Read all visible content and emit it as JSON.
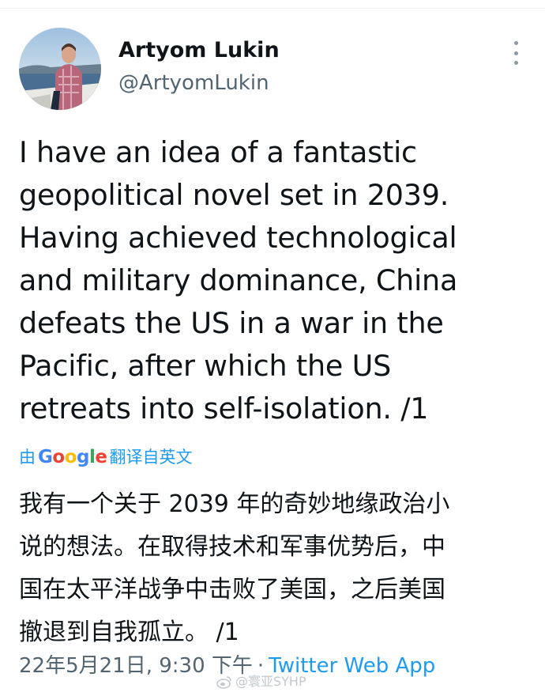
{
  "author": {
    "display_name": "Artyom Lukin",
    "handle": "@ArtyomLukin"
  },
  "tweet": {
    "text": "I have an idea of a fantastic\ngeopolitical novel set in 2039.\nHaving achieved technological\nand military dominance, China\ndefeats the US in a war in the\nPacific, after which the US\nretreats into self-isolation. /1"
  },
  "translation": {
    "prefix": "由",
    "provider": "Google",
    "label": "翻译自英文",
    "text": "我有一个关于 2039 年的奇妙地缘政治小\n说的想法。在取得技术和军事优势后，中\n国在太平洋战争中击败了美国，之后美国\n撤退到自我孤立。 /1"
  },
  "meta": {
    "timestamp": "22年5月21日, 9:30 下午",
    "separator": "·",
    "source": "Twitter Web App"
  },
  "watermark": {
    "text": "@寰亚SYHP",
    "icon": "weibo-icon"
  },
  "icons": {
    "more": "more-vertical-icon"
  },
  "colors": {
    "link": "#1d9bf0",
    "secondary_text": "#536471",
    "primary_text": "#0f1419"
  }
}
